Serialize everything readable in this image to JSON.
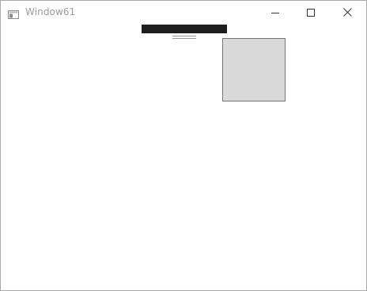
{
  "window": {
    "title": "Window61",
    "icon": "window-app-icon"
  },
  "caption_buttons": {
    "minimize_icon": "minimize-icon",
    "maximize_icon": "maximize-icon",
    "close_icon": "close-icon"
  },
  "client_area": {
    "top_strip_color": "#1e1e1e",
    "panel_color": "#dadada",
    "panel_border_color": "#767676"
  }
}
